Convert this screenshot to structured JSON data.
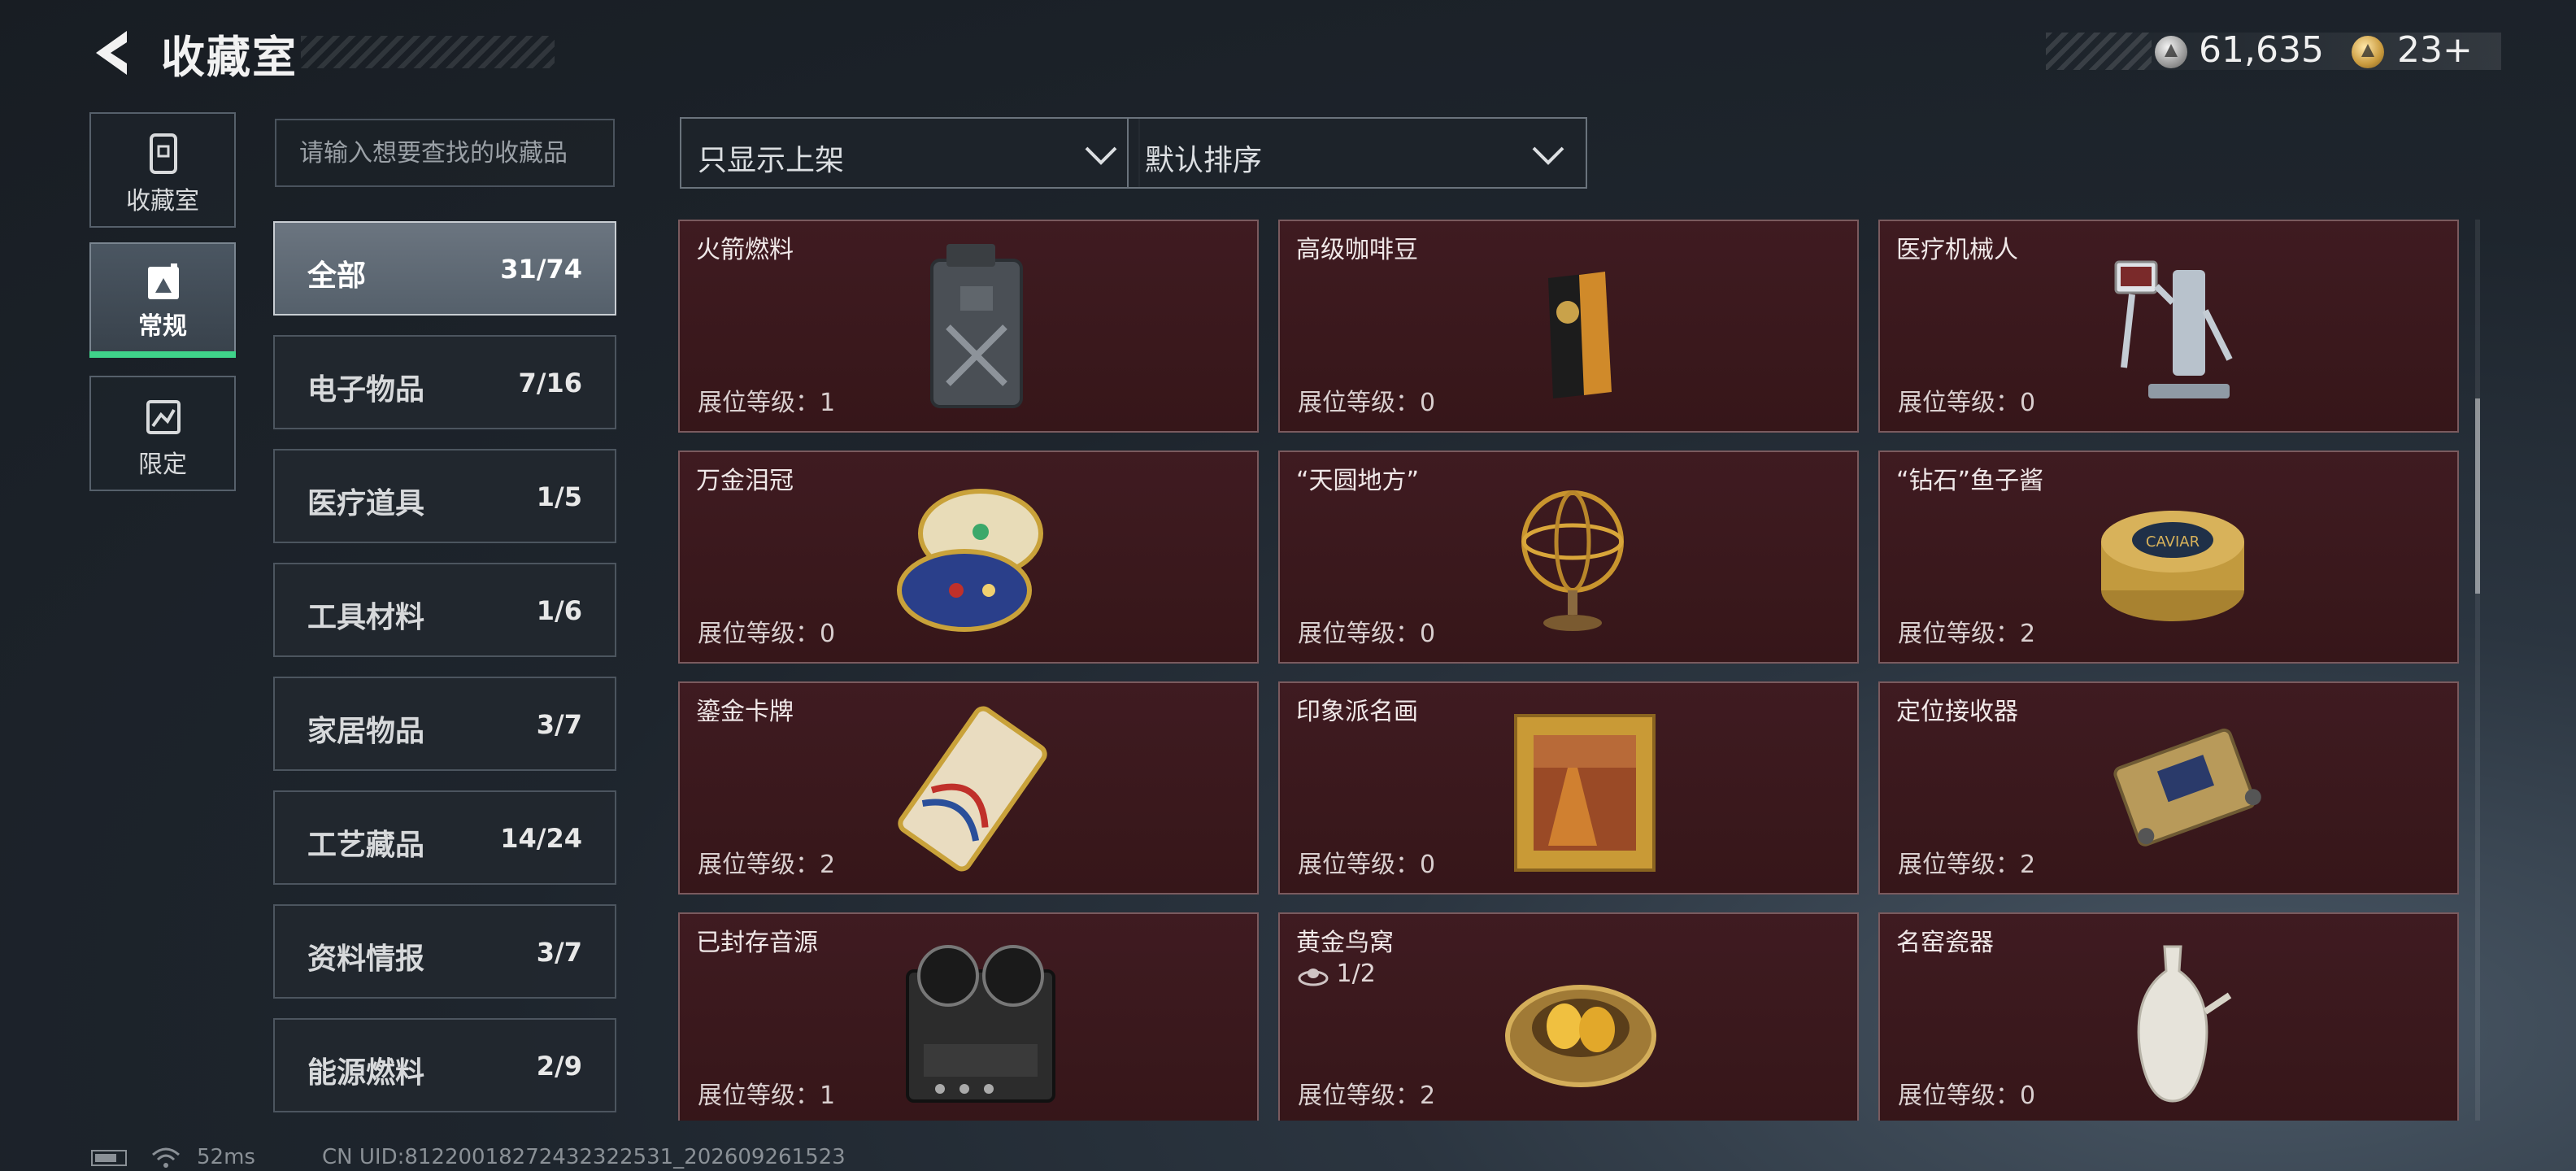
{
  "header": {
    "title": "收藏室",
    "currency_silver": "61,635",
    "currency_gold": "23+"
  },
  "rail": [
    {
      "label": "收藏室",
      "icon": "collection-room-icon"
    },
    {
      "label": "常规",
      "icon": "regular-icon",
      "active": true
    },
    {
      "label": "限定",
      "icon": "limited-icon"
    }
  ],
  "search": {
    "placeholder": "请输入想要查找的收藏品"
  },
  "filters": {
    "shelf_filter": "只显示上架",
    "sort": "默认排序"
  },
  "categories": [
    {
      "name": "全部",
      "count": "31/74",
      "active": true
    },
    {
      "name": "电子物品",
      "count": "7/16"
    },
    {
      "name": "医疗道具",
      "count": "1/5"
    },
    {
      "name": "工具材料",
      "count": "1/6"
    },
    {
      "name": "家居物品",
      "count": "3/7"
    },
    {
      "name": "工艺藏品",
      "count": "14/24"
    },
    {
      "name": "资料情报",
      "count": "3/7"
    },
    {
      "name": "能源燃料",
      "count": "2/9"
    }
  ],
  "items": [
    {
      "name": "火箭燃料",
      "level": "展位等级：1",
      "icon": "fuel-jerrycan-icon"
    },
    {
      "name": "高级咖啡豆",
      "level": "展位等级：0",
      "icon": "coffee-bag-icon"
    },
    {
      "name": "医疗机械人",
      "level": "展位等级：0",
      "icon": "medical-robot-icon"
    },
    {
      "name": "万金泪冠",
      "level": "展位等级：0",
      "icon": "jeweled-egg-icon"
    },
    {
      "name": "“天圆地方”",
      "level": "展位等级：0",
      "icon": "armillary-sphere-icon"
    },
    {
      "name": "“钻石”鱼子酱",
      "level": "展位等级：2",
      "icon": "caviar-tin-icon"
    },
    {
      "name": "鎏金卡牌",
      "level": "展位等级：2",
      "icon": "gilded-card-icon"
    },
    {
      "name": "印象派名画",
      "level": "展位等级：0",
      "icon": "framed-painting-icon"
    },
    {
      "name": "定位接收器",
      "level": "展位等级：2",
      "icon": "receiver-device-icon"
    },
    {
      "name": "已封存音源",
      "level": "展位等级：1",
      "icon": "tape-recorder-icon"
    },
    {
      "name": "黄金鸟窝",
      "level": "展位等级：2",
      "icon": "golden-nest-icon",
      "extra": "1/2"
    },
    {
      "name": "名窑瓷器",
      "level": "展位等级：0",
      "icon": "porcelain-vase-icon"
    }
  ],
  "caviar_label": "CAVIAR",
  "status": {
    "ping": "52ms",
    "uid": "CN UID:81220018272432322531_202609261523"
  },
  "colors": {
    "accent_green": "#3fd38a",
    "card_bg": "#3f1b21",
    "card_border": "#7a5a5e"
  }
}
